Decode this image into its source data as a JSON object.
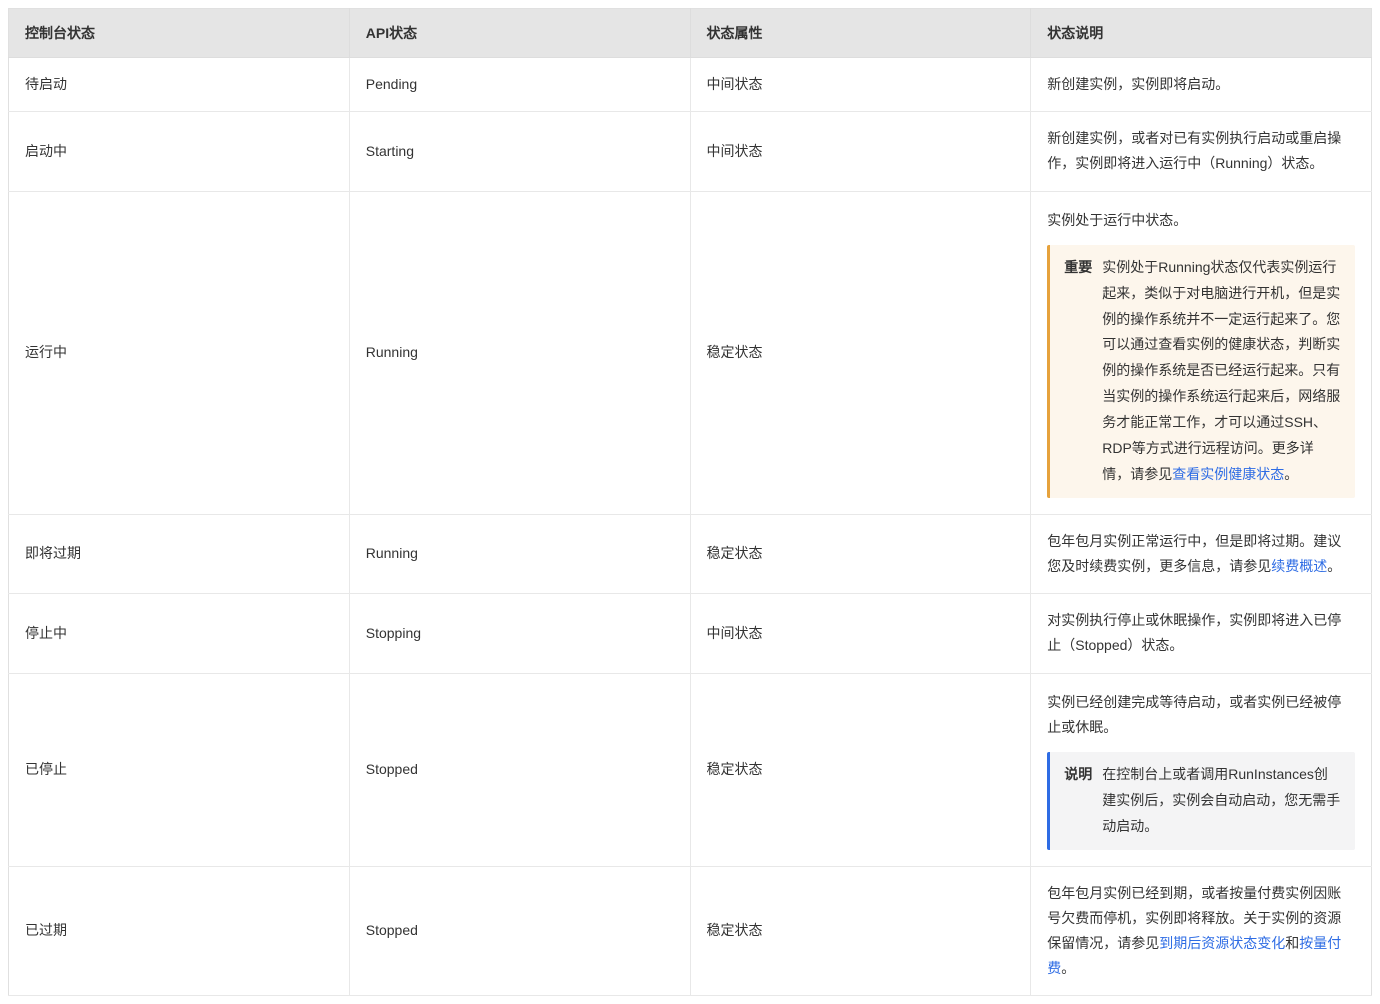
{
  "table": {
    "headers": {
      "console_status": "控制台状态",
      "api_status": "API状态",
      "status_attribute": "状态属性",
      "status_description": "状态说明"
    },
    "note_labels": {
      "important": "重要",
      "info": "说明"
    },
    "rows": [
      {
        "console": "待启动",
        "api": "Pending",
        "attr": "中间状态",
        "desc": "新创建实例，实例即将启动。"
      },
      {
        "console": "启动中",
        "api": "Starting",
        "attr": "中间状态",
        "desc": "新创建实例，或者对已有实例执行启动或重启操作，实例即将进入运行中（Running）状态。"
      },
      {
        "console": "运行中",
        "api": "Running",
        "attr": "稳定状态",
        "desc_pre": "实例处于运行中状态。",
        "note_type": "important",
        "note_text_1": "实例处于Running状态仅代表实例运行起来，类似于对电脑进行开机，但是实例的操作系统并不一定运行起来了。您可以通过查看实例的健康状态，判断实例的操作系统是否已经运行起来。只有当实例的操作系统运行起来后，网络服务才能正常工作，才可以通过SSH、RDP等方式进行远程访问。更多详情，请参见",
        "note_link_1": "查看实例健康状态",
        "note_text_2": "。"
      },
      {
        "console": "即将过期",
        "api": "Running",
        "attr": "稳定状态",
        "desc_1": "包年包月实例正常运行中，但是即将过期。建议您及时续费实例，更多信息，请参见",
        "link_1": "续费概述",
        "desc_2": "。"
      },
      {
        "console": "停止中",
        "api": "Stopping",
        "attr": "中间状态",
        "desc": "对实例执行停止或休眠操作，实例即将进入已停止（Stopped）状态。"
      },
      {
        "console": "已停止",
        "api": "Stopped",
        "attr": "稳定状态",
        "desc_pre": "实例已经创建完成等待启动，或者实例已经被停止或休眠。",
        "note_type": "info",
        "note_text_1": "在控制台上或者调用RunInstances创建实例后，实例会自动启动，您无需手动启动。"
      },
      {
        "console": "已过期",
        "api": "Stopped",
        "attr": "稳定状态",
        "desc_1": "包年包月实例已经到期，或者按量付费实例因账号欠费而停机，实例即将释放。关于实例的资源保留情况，请参见",
        "link_1": "到期后资源状态变化",
        "desc_2": "和",
        "link_2": "按量付费",
        "desc_3": "。"
      }
    ]
  }
}
